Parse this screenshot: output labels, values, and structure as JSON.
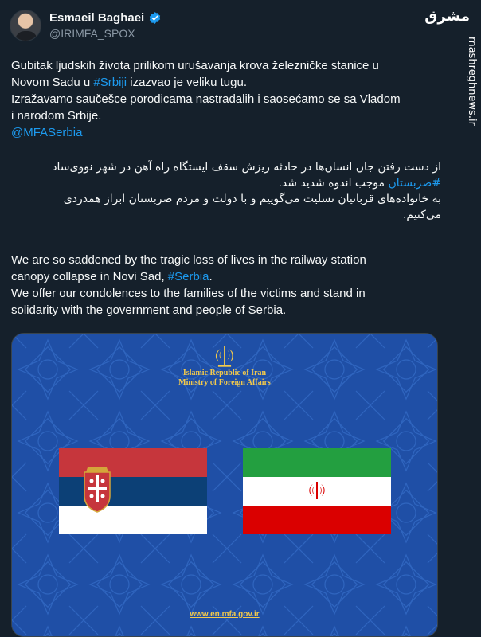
{
  "author": {
    "display_name": "Esmaeil Baghaei",
    "handle": "@IRIMFA_SPOX",
    "verified": true,
    "verified_icon": "verified-badge-icon"
  },
  "watermark": {
    "logo_text": "مشرق",
    "url": "mashreghnews.ir"
  },
  "tweet": {
    "bosnian": {
      "line1": "Gubitak ljudskih života prilikom urušavanja krova železničke stanice u",
      "line2_pre": "Novom Sadu u ",
      "line2_tag": "#Srbiji",
      "line2_post": " izazvao je veliku tugu.",
      "line3": "Izražavamo saučešce porodicama nastradalih i saosećamo se sa Vladom",
      "line4": "i narodom Srbije.",
      "mention": "@MFASerbia"
    },
    "persian": {
      "line1": "از دست رفتن جان انسان‌ها در حادثه ریزش سقف ایستگاه راه آهن در شهر نووی‌ساد",
      "line2_tag": "#صربستان",
      "line2_post": " موجب اندوه شدید شد.",
      "line3": "به خانواده‌های قربانیان تسلیت می‌گوییم و با دولت و مردم صربستان ابراز همدردی",
      "line4": "می‌کنیم."
    },
    "english": {
      "line1": "We are so saddened by the tragic loss of lives in the railway station",
      "line2_pre": "canopy collapse in Novi Sad, ",
      "line2_tag": "#Serbia",
      "line2_post": ".",
      "line3": "We offer our condolences to the families of the victims and stand in",
      "line4": "solidarity with the government and people of Serbia."
    }
  },
  "media": {
    "emblem_icon": "iran-emblem-icon",
    "title_line1": "Islamic Republic of Iran",
    "title_line2": "Ministry of Foreign Affairs",
    "flag_left": "serbia-flag",
    "flag_right": "iran-flag",
    "website": "www.en.mfa.gov.ir",
    "colors": {
      "background": "#1f4fa6",
      "gold": "#f2c94c",
      "serbia_red": "#c6363c",
      "serbia_blue": "#0c4076",
      "iran_green": "#239f40",
      "iran_red": "#da0000"
    }
  }
}
